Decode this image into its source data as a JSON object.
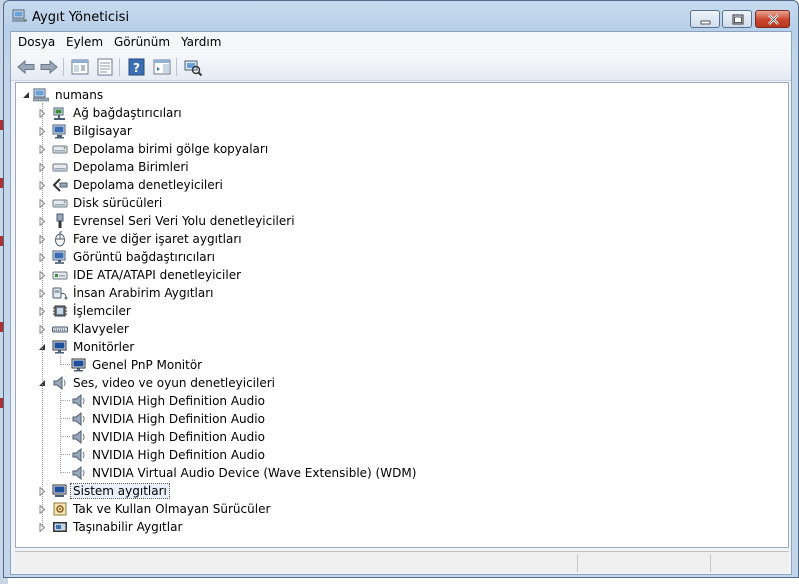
{
  "window": {
    "title": "Aygıt Yöneticisi",
    "controls": {
      "minimize": "minimize",
      "maximize": "maximize",
      "close": "close"
    }
  },
  "menu": {
    "items": [
      "Dosya",
      "Eylem",
      "Görünüm",
      "Yardım"
    ]
  },
  "toolbar": {
    "buttons": [
      "back-arrow-icon",
      "forward-arrow-icon",
      "show-hide-tree-icon",
      "properties-icon",
      "help-icon",
      "action-pane-icon",
      "scan-hardware-icon"
    ]
  },
  "tree": {
    "root": "numans",
    "items": [
      {
        "label": "Ağ bağdaştırıcıları",
        "icon": "network-adapter-icon",
        "expanded": false
      },
      {
        "label": "Bilgisayar",
        "icon": "computer-icon",
        "expanded": false
      },
      {
        "label": "Depolama birimi gölge kopyaları",
        "icon": "storage-volume-shadow-icon",
        "expanded": false
      },
      {
        "label": "Depolama Birimleri",
        "icon": "storage-volume-icon",
        "expanded": false
      },
      {
        "label": "Depolama denetleyicileri",
        "icon": "storage-controller-icon",
        "expanded": false
      },
      {
        "label": "Disk sürücüleri",
        "icon": "disk-drive-icon",
        "expanded": false
      },
      {
        "label": "Evrensel Seri Veri Yolu denetleyicileri",
        "icon": "usb-icon",
        "expanded": false
      },
      {
        "label": "Fare ve diğer işaret aygıtları",
        "icon": "mouse-icon",
        "expanded": false
      },
      {
        "label": "Görüntü bağdaştırıcıları",
        "icon": "display-adapter-icon",
        "expanded": false
      },
      {
        "label": "IDE ATA/ATAPI denetleyiciler",
        "icon": "ide-controller-icon",
        "expanded": false
      },
      {
        "label": "İnsan Arabirim Aygıtları",
        "icon": "hid-icon",
        "expanded": false
      },
      {
        "label": "İşlemciler",
        "icon": "processor-icon",
        "expanded": false
      },
      {
        "label": "Klavyeler",
        "icon": "keyboard-icon",
        "expanded": false
      },
      {
        "label": "Monitörler",
        "icon": "monitor-icon",
        "expanded": true,
        "children": [
          "Genel PnP Monitör"
        ]
      },
      {
        "label": "Ses, video ve oyun denetleyicileri",
        "icon": "speaker-icon",
        "expanded": true,
        "children": [
          "NVIDIA High Definition Audio",
          "NVIDIA High Definition Audio",
          "NVIDIA High Definition Audio",
          "NVIDIA High Definition Audio",
          "NVIDIA Virtual Audio Device (Wave Extensible) (WDM)"
        ]
      },
      {
        "label": "Sistem aygıtları",
        "icon": "system-device-icon",
        "expanded": false,
        "selected": true
      },
      {
        "label": "Tak ve Kullan Olmayan Sürücüler",
        "icon": "non-pnp-driver-icon",
        "expanded": false
      },
      {
        "label": "Taşınabilir Aygıtlar",
        "icon": "portable-device-icon",
        "expanded": false
      }
    ]
  },
  "colors": {
    "title_gradient": "#c3d6ea",
    "close_button": "#c9452c",
    "selection": "#e8f0fb"
  }
}
